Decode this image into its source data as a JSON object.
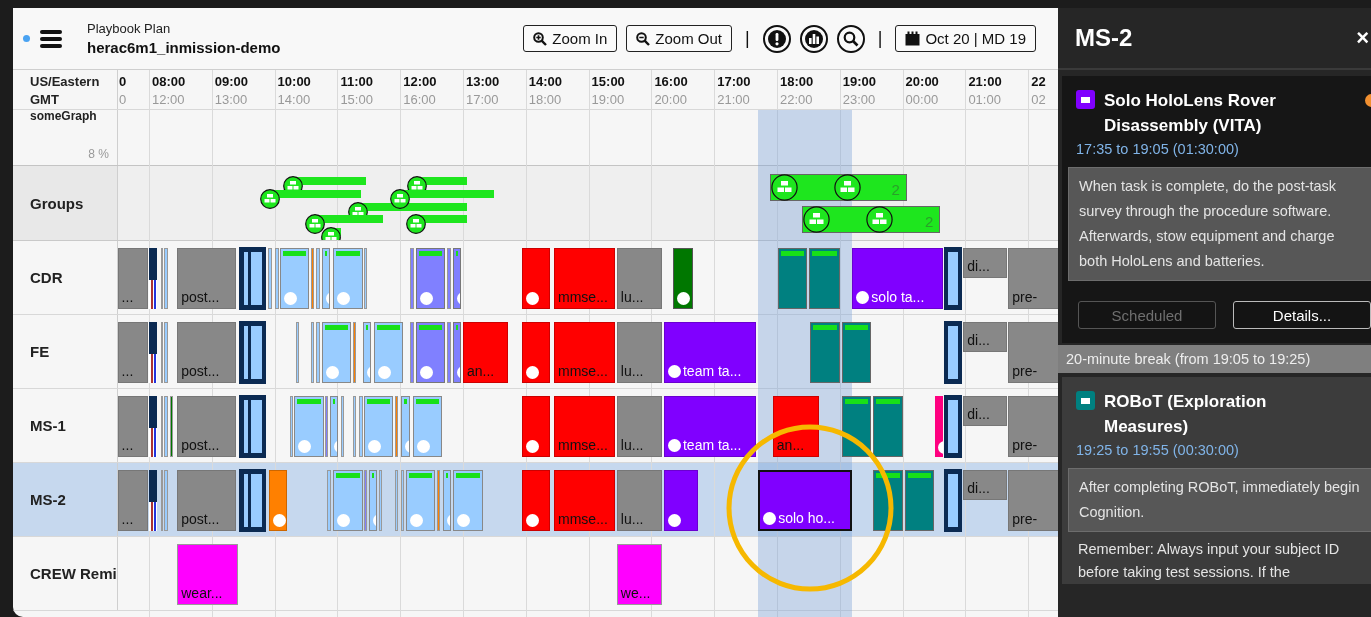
{
  "app": {
    "subtitle": "Playbook Plan",
    "title": "herac6m1_inmission-demo"
  },
  "toolbar": [
    {
      "kind": "zoom-in",
      "label": "Zoom In"
    },
    {
      "kind": "zoom-out",
      "label": "Zoom Out"
    },
    {
      "kind": "separator",
      "label": "|"
    },
    {
      "kind": "alert"
    },
    {
      "kind": "chart"
    },
    {
      "kind": "search"
    },
    {
      "kind": "separator",
      "label": "|"
    },
    {
      "kind": "date",
      "label": "Oct 20 | MD 19"
    }
  ],
  "timezones": [
    "US/Eastern",
    "GMT"
  ],
  "hours": [
    {
      "local": "0",
      "gmt": "0"
    },
    {
      "local": "08:00",
      "gmt": "12:00"
    },
    {
      "local": "09:00",
      "gmt": "13:00"
    },
    {
      "local": "10:00",
      "gmt": "14:00"
    },
    {
      "local": "11:00",
      "gmt": "15:00"
    },
    {
      "local": "12:00",
      "gmt": "16:00"
    },
    {
      "local": "13:00",
      "gmt": "17:00"
    },
    {
      "local": "14:00",
      "gmt": "18:00"
    },
    {
      "local": "15:00",
      "gmt": "19:00"
    },
    {
      "local": "16:00",
      "gmt": "20:00"
    },
    {
      "local": "17:00",
      "gmt": "21:00"
    },
    {
      "local": "18:00",
      "gmt": "22:00"
    },
    {
      "local": "19:00",
      "gmt": "23:00"
    },
    {
      "local": "20:00",
      "gmt": "00:00"
    },
    {
      "local": "21:00",
      "gmt": "01:00"
    },
    {
      "local": "22",
      "gmt": "02"
    }
  ],
  "graph_row": {
    "label": "someGraph",
    "value": "8 %"
  },
  "groups_row": {
    "label": "Groups",
    "items": [
      {
        "kind": "single"
      },
      {
        "kind": "single"
      },
      {
        "kind": "single"
      },
      {
        "kind": "single"
      },
      {
        "kind": "single"
      },
      {
        "kind": "single"
      },
      {
        "kind": "single"
      },
      {
        "kind": "single"
      },
      {
        "kind": "pair",
        "count": "2"
      },
      {
        "kind": "pair",
        "count": "2"
      }
    ]
  },
  "rows": [
    {
      "label": "CDR",
      "selected": false,
      "blocks": [
        {
          "kind": "gray",
          "label": "...",
          "dot": false,
          "stripe": false,
          "selected": false
        },
        {
          "kind": "marker",
          "dot": false,
          "stripe": false,
          "selected": false
        },
        {
          "kind": "sliver-orange",
          "dot": false,
          "stripe": false,
          "selected": false
        },
        {
          "kind": "sliver-blue",
          "dot": false,
          "stripe": false,
          "selected": false
        },
        {
          "kind": "gray",
          "label": "post...",
          "dot": false,
          "stripe": false,
          "selected": false
        },
        {
          "kind": "bracket",
          "dot": false,
          "stripe": false,
          "selected": false
        },
        {
          "kind": "sliver-blue",
          "dot": false,
          "stripe": false,
          "selected": false
        },
        {
          "kind": "sliver-blue",
          "dot": false,
          "stripe": false,
          "selected": false
        },
        {
          "kind": "lightblue",
          "dot": true,
          "stripe": true,
          "selected": false
        },
        {
          "kind": "sliver-orange",
          "dot": false,
          "stripe": false,
          "selected": false
        },
        {
          "kind": "sliver-blue",
          "dot": false,
          "stripe": false,
          "selected": false
        },
        {
          "kind": "lightblue",
          "dot": true,
          "stripe": true,
          "selected": false
        },
        {
          "kind": "lightblue",
          "dot": true,
          "stripe": true,
          "selected": false
        },
        {
          "kind": "sliver-blue",
          "dot": false,
          "stripe": false,
          "selected": false
        },
        {
          "kind": "sliver-violet",
          "dot": false,
          "stripe": false,
          "selected": false
        },
        {
          "kind": "violet",
          "dot": true,
          "stripe": true,
          "selected": false
        },
        {
          "kind": "sliver-violet",
          "dot": false,
          "stripe": false,
          "selected": false
        },
        {
          "kind": "violet",
          "dot": true,
          "stripe": true,
          "selected": false
        },
        {
          "kind": "red",
          "dot": true,
          "stripe": false,
          "selected": false
        },
        {
          "kind": "red",
          "label": "mmse...",
          "dot": false,
          "stripe": false,
          "selected": false
        },
        {
          "kind": "gray",
          "label": "lu...",
          "dot": false,
          "stripe": false,
          "selected": false
        },
        {
          "kind": "green",
          "dot": true,
          "stripe": false,
          "selected": false
        },
        {
          "kind": "teal",
          "dot": false,
          "stripe": true,
          "selected": false
        },
        {
          "kind": "teal",
          "dot": false,
          "stripe": true,
          "selected": false
        },
        {
          "kind": "purple",
          "label": "solo ta...",
          "dot": true,
          "stripe": false,
          "selected": false
        },
        {
          "kind": "bracket-single",
          "dot": false,
          "stripe": false,
          "selected": false
        },
        {
          "kind": "gray-half",
          "label": "di...",
          "dot": false,
          "stripe": false,
          "selected": false
        },
        {
          "kind": "gray",
          "label": "pre-",
          "dot": false,
          "stripe": false,
          "selected": false
        }
      ]
    },
    {
      "label": "FE",
      "selected": false,
      "blocks": [
        {
          "kind": "gray",
          "label": "...",
          "dot": false,
          "stripe": false,
          "selected": false
        },
        {
          "kind": "marker",
          "dot": false,
          "stripe": false,
          "selected": false
        },
        {
          "kind": "sliver-orange",
          "dot": false,
          "stripe": false,
          "selected": false
        },
        {
          "kind": "sliver-blue",
          "dot": false,
          "stripe": false,
          "selected": false
        },
        {
          "kind": "gray",
          "label": "post...",
          "dot": false,
          "stripe": false,
          "selected": false
        },
        {
          "kind": "bracket",
          "dot": false,
          "stripe": false,
          "selected": false
        },
        {
          "kind": "sliver-blue",
          "dot": false,
          "stripe": false,
          "selected": false
        },
        {
          "kind": "sliver-blue",
          "dot": false,
          "stripe": false,
          "selected": false
        },
        {
          "kind": "sliver-blue",
          "dot": false,
          "stripe": false,
          "selected": false
        },
        {
          "kind": "lightblue",
          "dot": true,
          "stripe": true,
          "selected": false
        },
        {
          "kind": "sliver-orange",
          "dot": false,
          "stripe": false,
          "selected": false
        },
        {
          "kind": "lightblue",
          "dot": true,
          "stripe": true,
          "selected": false
        },
        {
          "kind": "lightblue",
          "dot": true,
          "stripe": true,
          "selected": false
        },
        {
          "kind": "sliver-violet",
          "dot": false,
          "stripe": false,
          "selected": false
        },
        {
          "kind": "violet",
          "dot": true,
          "stripe": true,
          "selected": false
        },
        {
          "kind": "sliver-violet",
          "dot": false,
          "stripe": false,
          "selected": false
        },
        {
          "kind": "violet",
          "dot": true,
          "stripe": true,
          "selected": false
        },
        {
          "kind": "red",
          "label": "an...",
          "dot": false,
          "stripe": false,
          "selected": false
        },
        {
          "kind": "red",
          "dot": true,
          "stripe": false,
          "selected": false
        },
        {
          "kind": "red",
          "label": "mmse...",
          "dot": false,
          "stripe": false,
          "selected": false
        },
        {
          "kind": "gray",
          "label": "lu...",
          "dot": false,
          "stripe": false,
          "selected": false
        },
        {
          "kind": "purple",
          "label": "team ta...",
          "dot": true,
          "stripe": false,
          "selected": false
        },
        {
          "kind": "teal",
          "dot": false,
          "stripe": true,
          "selected": false
        },
        {
          "kind": "teal",
          "dot": false,
          "stripe": true,
          "selected": false
        },
        {
          "kind": "bracket-single",
          "dot": false,
          "stripe": false,
          "selected": false
        },
        {
          "kind": "gray-half",
          "label": "di...",
          "dot": false,
          "stripe": false,
          "selected": false
        },
        {
          "kind": "gray",
          "label": "pre-",
          "dot": false,
          "stripe": false,
          "selected": false
        }
      ]
    },
    {
      "label": "MS-1",
      "selected": false,
      "blocks": [
        {
          "kind": "gray",
          "label": "...",
          "dot": false,
          "stripe": false,
          "selected": false
        },
        {
          "kind": "marker",
          "dot": false,
          "stripe": false,
          "selected": false
        },
        {
          "kind": "sliver-orange",
          "dot": false,
          "stripe": false,
          "selected": false
        },
        {
          "kind": "sliver-blue",
          "dot": false,
          "stripe": false,
          "selected": false
        },
        {
          "kind": "sliver-green",
          "dot": false,
          "stripe": false,
          "selected": false
        },
        {
          "kind": "gray",
          "label": "post...",
          "dot": false,
          "stripe": false,
          "selected": false
        },
        {
          "kind": "bracket",
          "dot": false,
          "stripe": false,
          "selected": false
        },
        {
          "kind": "sliver-blue",
          "dot": false,
          "stripe": false,
          "selected": false
        },
        {
          "kind": "lightblue",
          "dot": true,
          "stripe": true,
          "selected": false
        },
        {
          "kind": "sliver-violet",
          "dot": false,
          "stripe": false,
          "selected": false
        },
        {
          "kind": "lightblue",
          "dot": true,
          "stripe": true,
          "selected": false
        },
        {
          "kind": "sliver-blue",
          "dot": false,
          "stripe": false,
          "selected": false
        },
        {
          "kind": "sliver-blue",
          "dot": false,
          "stripe": false,
          "selected": false
        },
        {
          "kind": "sliver-blue",
          "dot": false,
          "stripe": false,
          "selected": false
        },
        {
          "kind": "lightblue",
          "dot": true,
          "stripe": true,
          "selected": false
        },
        {
          "kind": "sliver-orange",
          "dot": false,
          "stripe": false,
          "selected": false
        },
        {
          "kind": "lightblue",
          "dot": true,
          "stripe": true,
          "selected": false
        },
        {
          "kind": "lightblue",
          "dot": true,
          "stripe": true,
          "selected": false
        },
        {
          "kind": "red",
          "dot": true,
          "stripe": false,
          "selected": false
        },
        {
          "kind": "red",
          "label": "mmse...",
          "dot": false,
          "stripe": false,
          "selected": false
        },
        {
          "kind": "gray",
          "label": "lu...",
          "dot": false,
          "stripe": false,
          "selected": false
        },
        {
          "kind": "purple",
          "label": "team ta...",
          "dot": true,
          "stripe": false,
          "selected": false
        },
        {
          "kind": "red",
          "label": "an...",
          "dot": false,
          "stripe": false,
          "selected": false
        },
        {
          "kind": "teal",
          "dot": false,
          "stripe": true,
          "selected": false
        },
        {
          "kind": "teal",
          "dot": false,
          "stripe": true,
          "selected": false
        },
        {
          "kind": "pink",
          "dot": true,
          "stripe": false,
          "selected": false
        },
        {
          "kind": "bracket-single",
          "dot": false,
          "stripe": false,
          "selected": false
        },
        {
          "kind": "gray-half",
          "label": "di...",
          "dot": false,
          "stripe": false,
          "selected": false
        },
        {
          "kind": "gray",
          "label": "pre-",
          "dot": false,
          "stripe": false,
          "selected": false
        }
      ]
    },
    {
      "label": "MS-2",
      "selected": true,
      "blocks": [
        {
          "kind": "gray",
          "label": "...",
          "dot": false,
          "stripe": false,
          "selected": false
        },
        {
          "kind": "marker",
          "dot": false,
          "stripe": false,
          "selected": false
        },
        {
          "kind": "sliver-orange",
          "dot": false,
          "stripe": false,
          "selected": false
        },
        {
          "kind": "sliver-blue",
          "dot": false,
          "stripe": false,
          "selected": false
        },
        {
          "kind": "gray",
          "label": "post...",
          "dot": false,
          "stripe": false,
          "selected": false
        },
        {
          "kind": "bracket",
          "dot": false,
          "stripe": false,
          "selected": false
        },
        {
          "kind": "orange",
          "dot": true,
          "stripe": false,
          "selected": false
        },
        {
          "kind": "sliver-blue",
          "dot": false,
          "stripe": false,
          "selected": false
        },
        {
          "kind": "lightblue",
          "dot": true,
          "stripe": true,
          "selected": false
        },
        {
          "kind": "sliver-violet",
          "dot": false,
          "stripe": false,
          "selected": false
        },
        {
          "kind": "lightblue",
          "dot": true,
          "stripe": true,
          "selected": false
        },
        {
          "kind": "sliver-blue",
          "dot": false,
          "stripe": false,
          "selected": false
        },
        {
          "kind": "sliver-blue",
          "dot": false,
          "stripe": false,
          "selected": false
        },
        {
          "kind": "sliver-blue",
          "dot": false,
          "stripe": false,
          "selected": false
        },
        {
          "kind": "lightblue",
          "dot": true,
          "stripe": true,
          "selected": false
        },
        {
          "kind": "sliver-orange",
          "dot": false,
          "stripe": false,
          "selected": false
        },
        {
          "kind": "lightblue",
          "dot": true,
          "stripe": true,
          "selected": false
        },
        {
          "kind": "lightblue",
          "dot": true,
          "stripe": true,
          "selected": false
        },
        {
          "kind": "red",
          "dot": true,
          "stripe": false,
          "selected": false
        },
        {
          "kind": "red",
          "label": "mmse...",
          "dot": false,
          "stripe": false,
          "selected": false
        },
        {
          "kind": "gray",
          "label": "lu...",
          "dot": false,
          "stripe": false,
          "selected": false
        },
        {
          "kind": "purple",
          "dot": true,
          "stripe": false,
          "selected": false
        },
        {
          "kind": "purple",
          "label": "solo ho...",
          "dot": true,
          "stripe": false,
          "selected": true
        },
        {
          "kind": "teal",
          "dot": false,
          "stripe": true,
          "selected": false
        },
        {
          "kind": "teal",
          "dot": false,
          "stripe": true,
          "selected": false
        },
        {
          "kind": "bracket-single",
          "dot": false,
          "stripe": false,
          "selected": false
        },
        {
          "kind": "gray-half",
          "label": "di...",
          "dot": false,
          "stripe": false,
          "selected": false
        },
        {
          "kind": "gray",
          "label": "pre-",
          "dot": false,
          "stripe": false,
          "selected": false
        }
      ]
    },
    {
      "label": "CREW Remi",
      "selected": false,
      "blocks": [
        {
          "kind": "magenta",
          "label": "wear...",
          "dot": false,
          "stripe": false,
          "selected": false
        },
        {
          "kind": "magenta",
          "label": "we...",
          "dot": false,
          "stripe": false,
          "selected": false
        }
      ]
    }
  ],
  "highlight_ring": true,
  "panel": {
    "title": "MS-2",
    "close": "×",
    "entries": [
      {
        "kind": "activity",
        "selected": true,
        "alert": true,
        "color": "#8000ff",
        "title": "Solo HoloLens Rover Disassembly (VITA)",
        "time": "17:35 to 19:05 (01:30:00)",
        "notes": "When task is complete, do the post-task survey through the procedure software. Afterwards, stow equipment and charge both HoloLens and batteries.",
        "buttons": [
          {
            "label": "Scheduled",
            "disabled": true
          },
          {
            "label": "Details...",
            "disabled": false
          }
        ]
      },
      {
        "kind": "break",
        "text": "20-minute break (from 19:05 to 19:25)"
      },
      {
        "kind": "activity",
        "selected": false,
        "alert": false,
        "color": "#008080",
        "title": "ROBoT (Exploration Measures)",
        "time": "19:25 to 19:55 (00:30:00)",
        "notes": "After completing ROBoT, immediately begin Cognition.",
        "footer": "Remember: Always input your subject ID before taking test sessions. If the"
      }
    ]
  }
}
